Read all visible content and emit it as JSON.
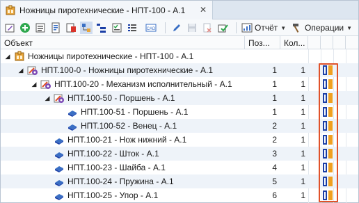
{
  "window": {
    "tab_title": "Ножницы пиротехнические - НПТ-100 - А.1",
    "tab_close": "✕"
  },
  "toolbar": {
    "buttons": [
      {
        "name": "edit-icon"
      },
      {
        "name": "add-icon"
      },
      {
        "name": "properties-icon"
      },
      {
        "name": "document-icon"
      },
      {
        "name": "export-icon"
      },
      {
        "name": "structure-icon"
      },
      {
        "name": "tree-icon"
      },
      {
        "name": "checklist-icon"
      },
      {
        "name": "list-icon"
      },
      {
        "name": "cad-icon"
      },
      {
        "name": "pencil-icon"
      },
      {
        "name": "save-icon"
      },
      {
        "name": "delete-icon"
      },
      {
        "name": "approve-icon"
      }
    ],
    "report_label": "Отчёт",
    "operations_label": "Операции"
  },
  "columns": {
    "object": "Объект",
    "position": "Поз...",
    "quantity": "Кол..."
  },
  "colors": {
    "accent_blue": "#1b3fa6",
    "flag_orange": "#f0a020",
    "highlight": "#e0522a"
  },
  "rows": [
    {
      "level": 0,
      "expander": "◢",
      "icon": "assembly-box-icon",
      "name": "Ножницы пиротехнические - НПТ-100 - А.1",
      "pos": "",
      "qty": "",
      "flag": false
    },
    {
      "level": 1,
      "expander": "◢",
      "icon": "assembly-icon",
      "name": "НПТ.100-0 - Ножницы пиротехнические - А.1",
      "pos": "1",
      "qty": "1",
      "flag": true
    },
    {
      "level": 2,
      "expander": "◢",
      "icon": "assembly-icon",
      "name": "НПТ.100-20 - Механизм исполнительный - А.1",
      "pos": "1",
      "qty": "1",
      "flag": true
    },
    {
      "level": 3,
      "expander": "◢",
      "icon": "assembly-icon",
      "name": "НПТ.100-50 - Поршень - А.1",
      "pos": "1",
      "qty": "1",
      "flag": true
    },
    {
      "level": 4,
      "expander": "",
      "icon": "part-icon",
      "name": "НПТ.100-51 - Поршень - А.1",
      "pos": "1",
      "qty": "1",
      "flag": true
    },
    {
      "level": 4,
      "expander": "",
      "icon": "part-icon",
      "name": "НПТ.100-52 - Венец - А.1",
      "pos": "2",
      "qty": "1",
      "flag": true
    },
    {
      "level": 3,
      "expander": "",
      "icon": "part-icon",
      "name": "НПТ.100-21 - Нож нижний - А.1",
      "pos": "2",
      "qty": "1",
      "flag": true
    },
    {
      "level": 3,
      "expander": "",
      "icon": "part-icon",
      "name": "НПТ.100-22 - Шток - А.1",
      "pos": "3",
      "qty": "1",
      "flag": true
    },
    {
      "level": 3,
      "expander": "",
      "icon": "part-icon",
      "name": "НПТ.100-23 - Шайба - А.1",
      "pos": "4",
      "qty": "1",
      "flag": true
    },
    {
      "level": 3,
      "expander": "",
      "icon": "part-icon",
      "name": "НПТ.100-24 - Пружина - А.1",
      "pos": "5",
      "qty": "1",
      "flag": true
    },
    {
      "level": 3,
      "expander": "",
      "icon": "part-icon",
      "name": "НПТ.100-25 - Упор - А.1",
      "pos": "6",
      "qty": "1",
      "flag": true
    }
  ]
}
